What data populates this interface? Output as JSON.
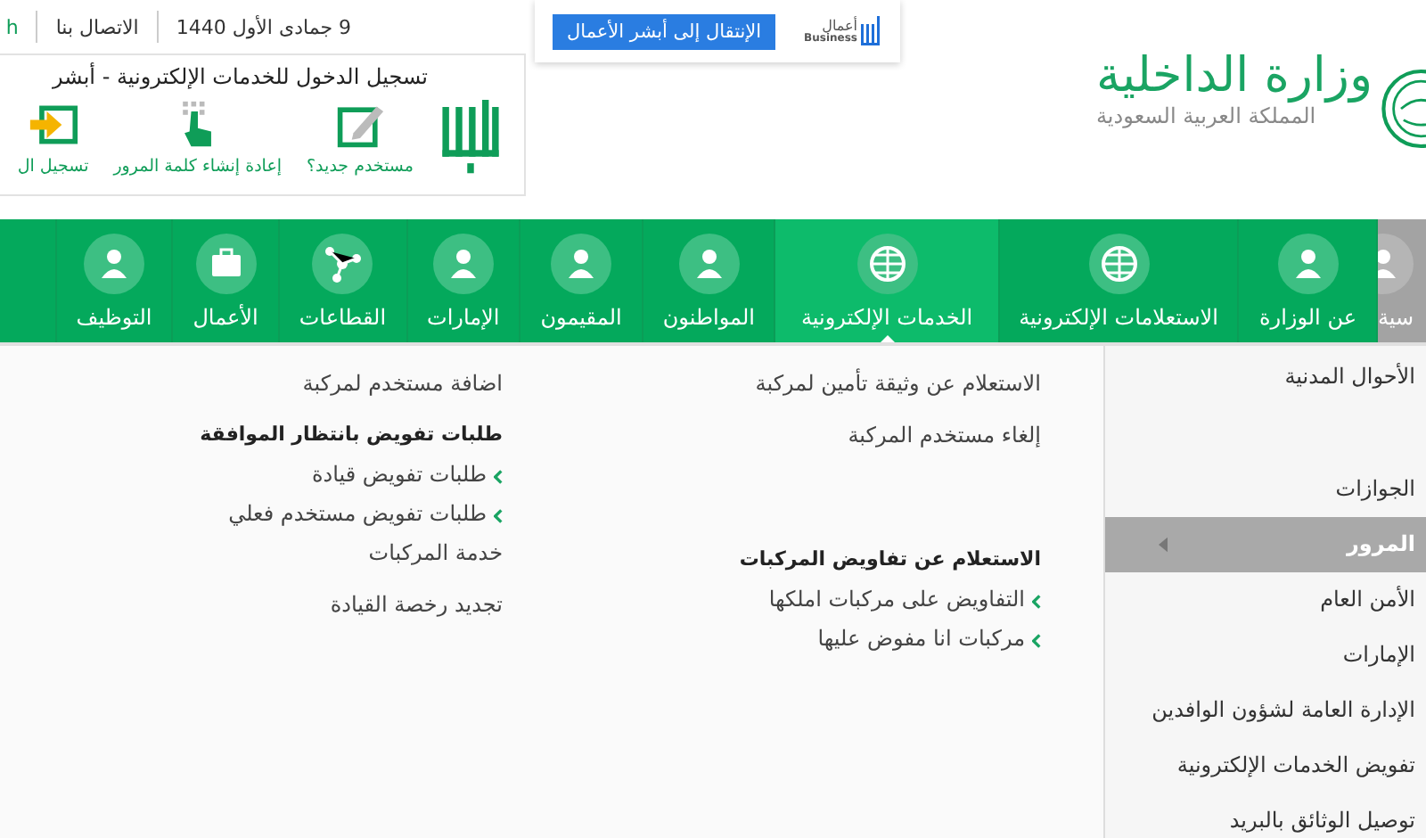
{
  "top_links": [
    {
      "text": "9 جمادى الأول 1440",
      "kind": "date"
    },
    {
      "text": "الاتصال بنا",
      "kind": "link"
    },
    {
      "text": "h",
      "kind": "lang"
    }
  ],
  "login": {
    "title": "تسجيل الدخول للخدمات الإلكترونية - أبشر",
    "actions": [
      {
        "label": "مستخدم جديد؟"
      },
      {
        "label": "إعادة إنشاء كلمة المرور"
      },
      {
        "label": "تسجيل ال"
      }
    ]
  },
  "business": {
    "logo_text": "أعمال",
    "logo_subtext": "Business",
    "button": "الإنتقال إلى أبشر الأعمال"
  },
  "brand": {
    "title": "وزارة الداخلية",
    "subtitle": "المملكة العربية السعودية"
  },
  "nav": [
    {
      "label": "سية",
      "kind": "home",
      "selected": false
    },
    {
      "label": "عن الوزارة",
      "kind": "section",
      "selected": false
    },
    {
      "label": "الاستعلامات الإلكترونية",
      "kind": "section",
      "selected": false
    },
    {
      "label": "الخدمات الإلكترونية",
      "kind": "section",
      "selected": true
    },
    {
      "label": "المواطنون",
      "kind": "section",
      "selected": false
    },
    {
      "label": "المقيمون",
      "kind": "section",
      "selected": false
    },
    {
      "label": "الإمارات",
      "kind": "section",
      "selected": false
    },
    {
      "label": "القطاعات",
      "kind": "section",
      "selected": false
    },
    {
      "label": "الأعمال",
      "kind": "section",
      "selected": false
    },
    {
      "label": "التوظيف",
      "kind": "section",
      "selected": false
    }
  ],
  "sidebar": [
    {
      "label": "الأحوال المدنية",
      "kind": "item",
      "selected": false
    },
    {
      "kind": "obscured"
    },
    {
      "label": "الجوازات",
      "kind": "item",
      "selected": false
    },
    {
      "label": "المرور",
      "kind": "item",
      "selected": true
    },
    {
      "label": "الأمن العام",
      "kind": "item",
      "selected": false
    },
    {
      "label": "الإمارات",
      "kind": "item",
      "selected": false
    },
    {
      "label": "الإدارة العامة لشؤون الوافدين",
      "kind": "item",
      "selected": false
    },
    {
      "label": "تفويض الخدمات الإلكترونية",
      "kind": "item",
      "selected": false
    },
    {
      "label": "توصيل الوثائق بالبريد",
      "kind": "item",
      "selected": false
    }
  ],
  "content": {
    "columns": [
      {
        "groups": [
          {
            "items": [
              {
                "kind": "link",
                "text": "الاستعلام عن وثيقة تأمين لمركبة"
              },
              {
                "kind": "link",
                "text": "إلغاء مستخدم المركبة"
              }
            ]
          },
          {
            "items": [
              {
                "kind": "heading",
                "text": "الاستعلام عن تفاويض المركبات"
              },
              {
                "kind": "sublink",
                "text": "التفاويض على مركبات املكها"
              },
              {
                "kind": "sublink",
                "text": "مركبات انا مفوض عليها"
              }
            ]
          }
        ]
      },
      {
        "groups": [
          {
            "items": [
              {
                "kind": "link",
                "text": "اضافة مستخدم لمركبة"
              },
              {
                "kind": "heading",
                "text": "طلبات تفويض بانتظار الموافقة"
              },
              {
                "kind": "sublink",
                "text": "طلبات تفويض قيادة"
              },
              {
                "kind": "sublink",
                "text": "طلبات تفويض مستخدم فعلي"
              }
            ]
          },
          {
            "items": [
              {
                "kind": "link",
                "text": "خدمة المركبات"
              },
              {
                "kind": "link",
                "text": "تجديد رخصة القيادة"
              }
            ]
          }
        ]
      }
    ]
  }
}
